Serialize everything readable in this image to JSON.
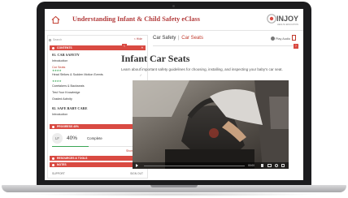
{
  "header": {
    "title": "Understanding Infant & Child Safety eClass",
    "logo_text": "INJOY",
    "logo_subtext": "HEALTH EDUCATION"
  },
  "sidebar": {
    "search_placeholder": "Search",
    "hide_label": "< Hide",
    "contents_label": "CONTENTS",
    "sections": [
      {
        "title": "01. CAR SAFETY",
        "items": [
          {
            "label": "Introduction",
            "status": "check"
          },
          {
            "label": "Car Seats",
            "status": "check"
          },
          {
            "label": "Head Strikes & Sudden Motion Events",
            "status": "check"
          },
          {
            "label": "Caretakers & Backseats",
            "status": ""
          },
          {
            "label": "Test Your Knowledge",
            "status": ""
          },
          {
            "label": "Graded Activity",
            "status": "check"
          }
        ]
      },
      {
        "title": "02. SAFE BABY CARE",
        "items": [
          {
            "label": "Introduction",
            "status": ""
          }
        ]
      }
    ],
    "progress_label": "PROGRESS 40%",
    "user_initials": "LF",
    "progress_percent": "40%",
    "progress_status": "Complete",
    "progress_value": 0.4,
    "show_details": "Show Details",
    "resources_label": "RESOURCES & TOOLS",
    "notes_label": "NOTES",
    "support_label": "SUPPORT",
    "signout_label": "SIGN OUT"
  },
  "content": {
    "breadcrumb_parent": "Car Safety",
    "breadcrumb_sep": "|",
    "breadcrumb_current": "Car Seats",
    "play_audio": "Play Audio",
    "prev_arrow": "‹",
    "next_arrow": "›",
    "page_title": "Infant Car Seats",
    "intro": "Learn about important safety guidelines for choosing, installing, and inspecting your baby's car seat.",
    "video_time": "00:00"
  },
  "colors": {
    "accent_red": "#d94a42",
    "title_red": "#b23a3a",
    "progress_green": "#3aa655"
  }
}
